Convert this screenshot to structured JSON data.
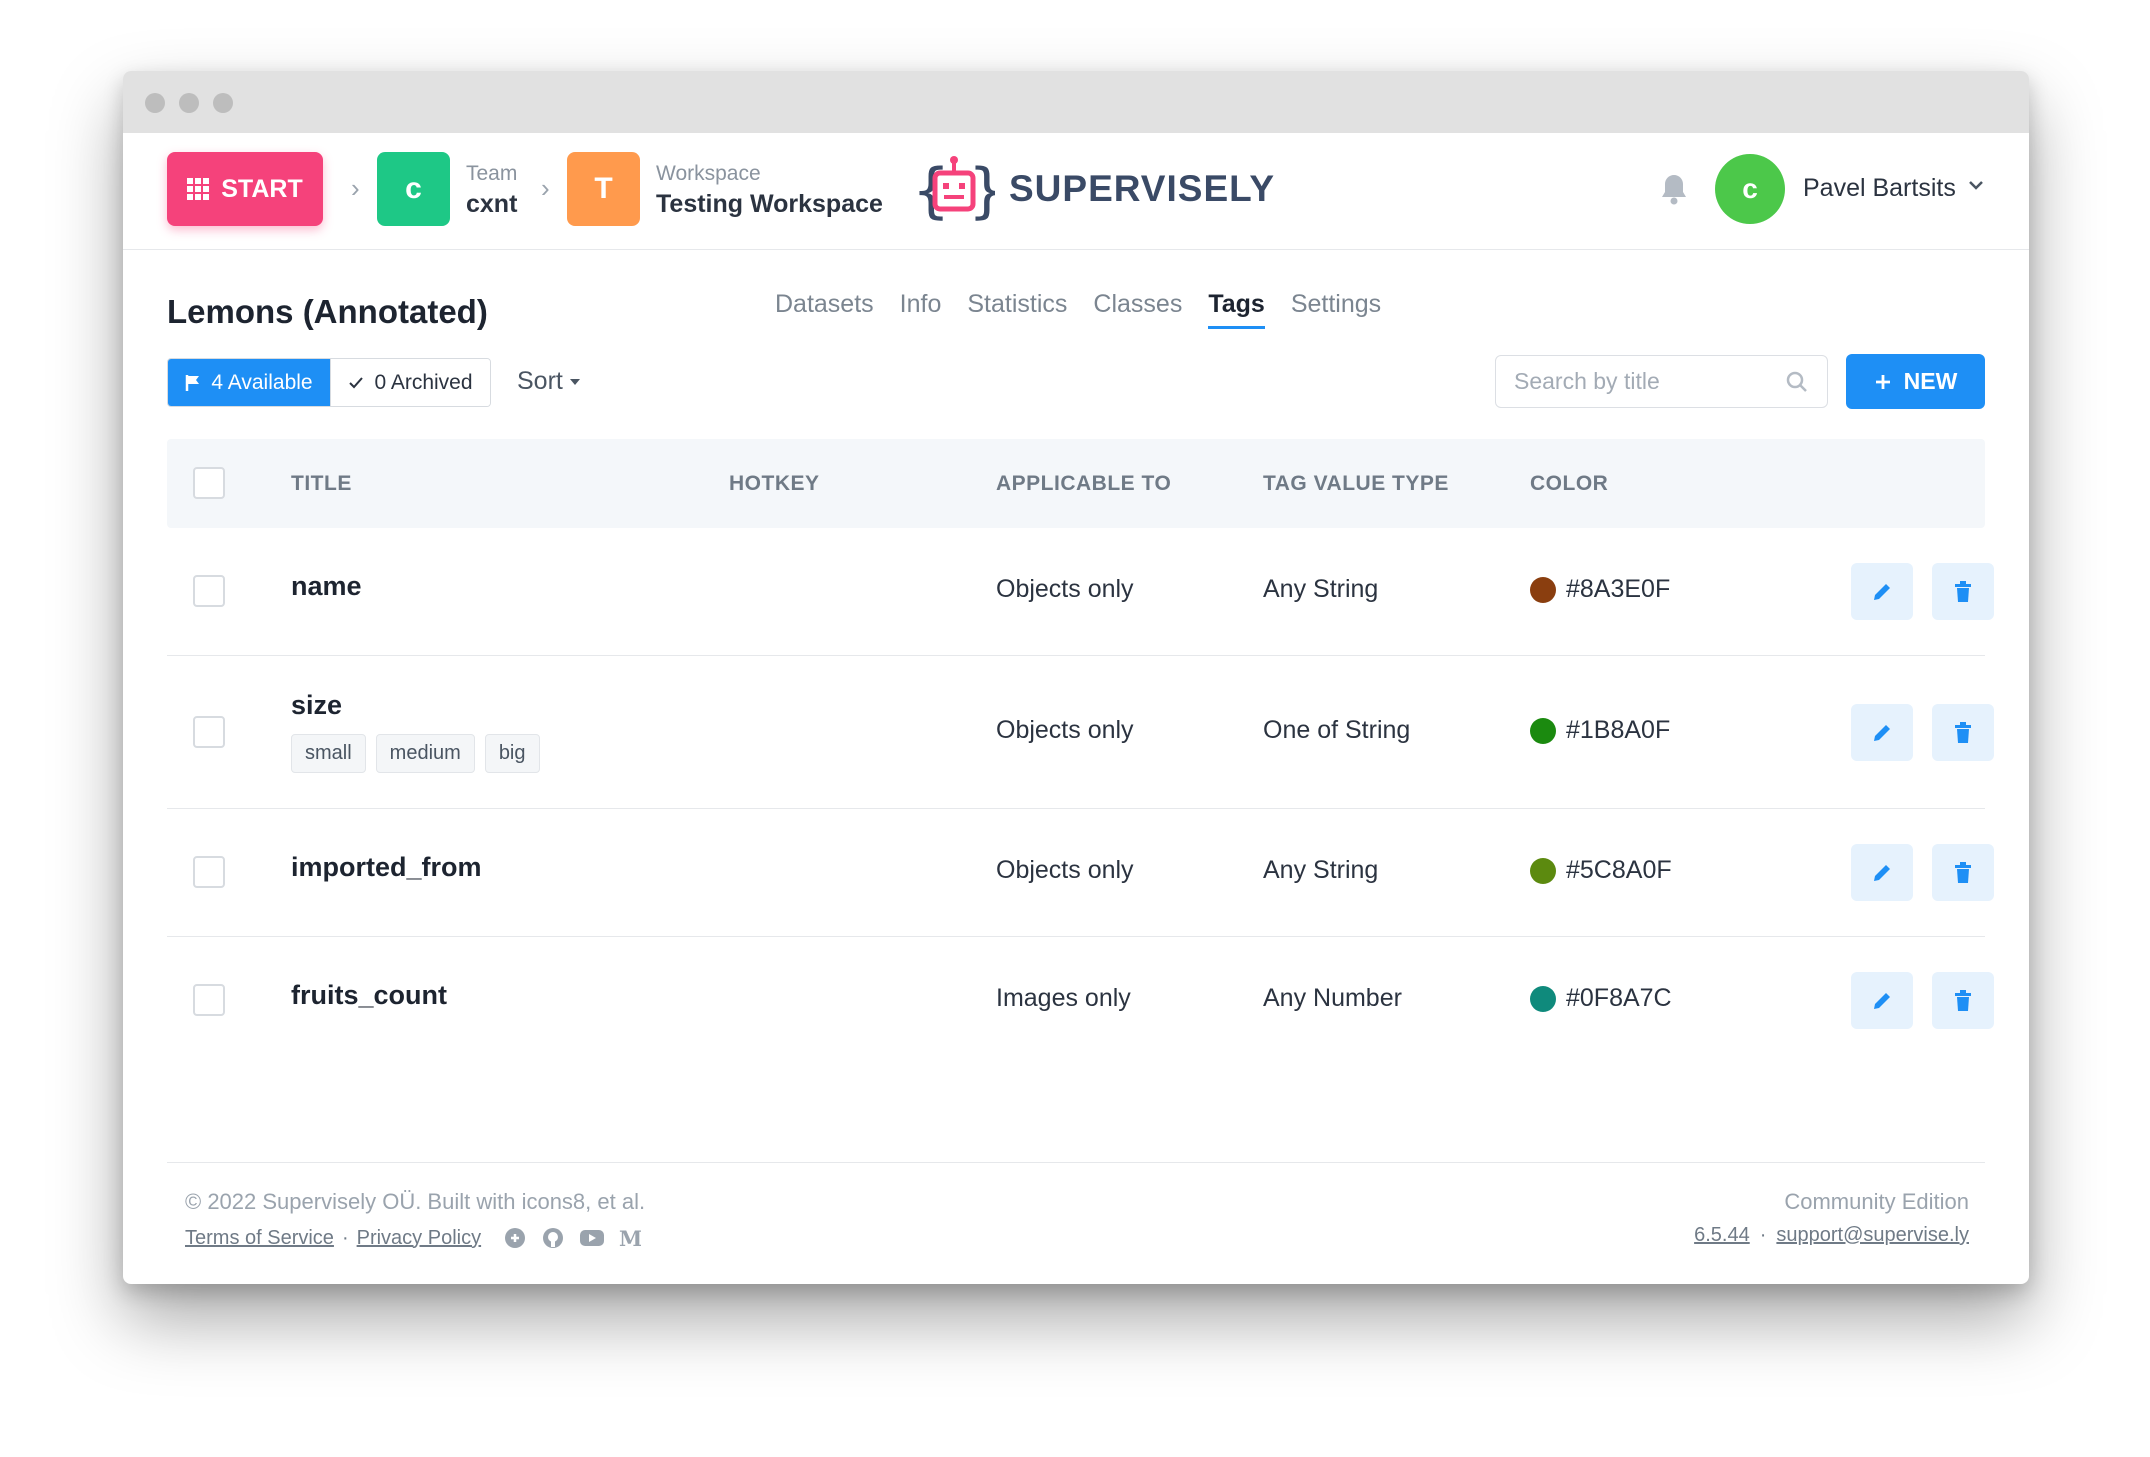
{
  "header": {
    "start_label": "START",
    "team_caption": "Team",
    "team_name": "cxnt",
    "team_initial": "c",
    "workspace_caption": "Workspace",
    "workspace_name": "Testing Workspace",
    "workspace_initial": "T",
    "brand": "SUPERVISELY",
    "user_initial": "c",
    "user_name": "Pavel Bartsits",
    "colors": {
      "start": "#f5427b",
      "team": "#1ec886",
      "workspace": "#ff9a4d",
      "avatar": "#4cc84a"
    }
  },
  "page": {
    "title": "Lemons (Annotated)",
    "tabs": [
      {
        "label": "Datasets",
        "active": false
      },
      {
        "label": "Info",
        "active": false
      },
      {
        "label": "Statistics",
        "active": false
      },
      {
        "label": "Classes",
        "active": false
      },
      {
        "label": "Tags",
        "active": true
      },
      {
        "label": "Settings",
        "active": false
      }
    ]
  },
  "controls": {
    "available_label": "4 Available",
    "archived_label": "0 Archived",
    "sort_label": "Sort",
    "search_placeholder": "Search by title",
    "new_label": "NEW"
  },
  "table": {
    "headers": {
      "title": "TITLE",
      "hotkey": "HOTKEY",
      "applicable": "APPLICABLE TO",
      "value_type": "TAG VALUE TYPE",
      "color": "COLOR"
    },
    "rows": [
      {
        "title": "name",
        "values": [],
        "hotkey": "",
        "applicable": "Objects only",
        "value_type": "Any String",
        "color": "#8A3E0F"
      },
      {
        "title": "size",
        "values": [
          "small",
          "medium",
          "big"
        ],
        "hotkey": "",
        "applicable": "Objects only",
        "value_type": "One of String",
        "color": "#1B8A0F"
      },
      {
        "title": "imported_from",
        "values": [],
        "hotkey": "",
        "applicable": "Objects only",
        "value_type": "Any String",
        "color": "#5C8A0F"
      },
      {
        "title": "fruits_count",
        "values": [],
        "hotkey": "",
        "applicable": "Images only",
        "value_type": "Any Number",
        "color": "#0F8A7C"
      }
    ]
  },
  "footer": {
    "copyright": "© 2022 Supervisely OÜ. Built with icons8, et al.",
    "terms": "Terms of Service",
    "sep": "·",
    "privacy": "Privacy Policy",
    "edition": "Community Edition",
    "version": "6.5.44",
    "support": "support@supervise.ly"
  }
}
